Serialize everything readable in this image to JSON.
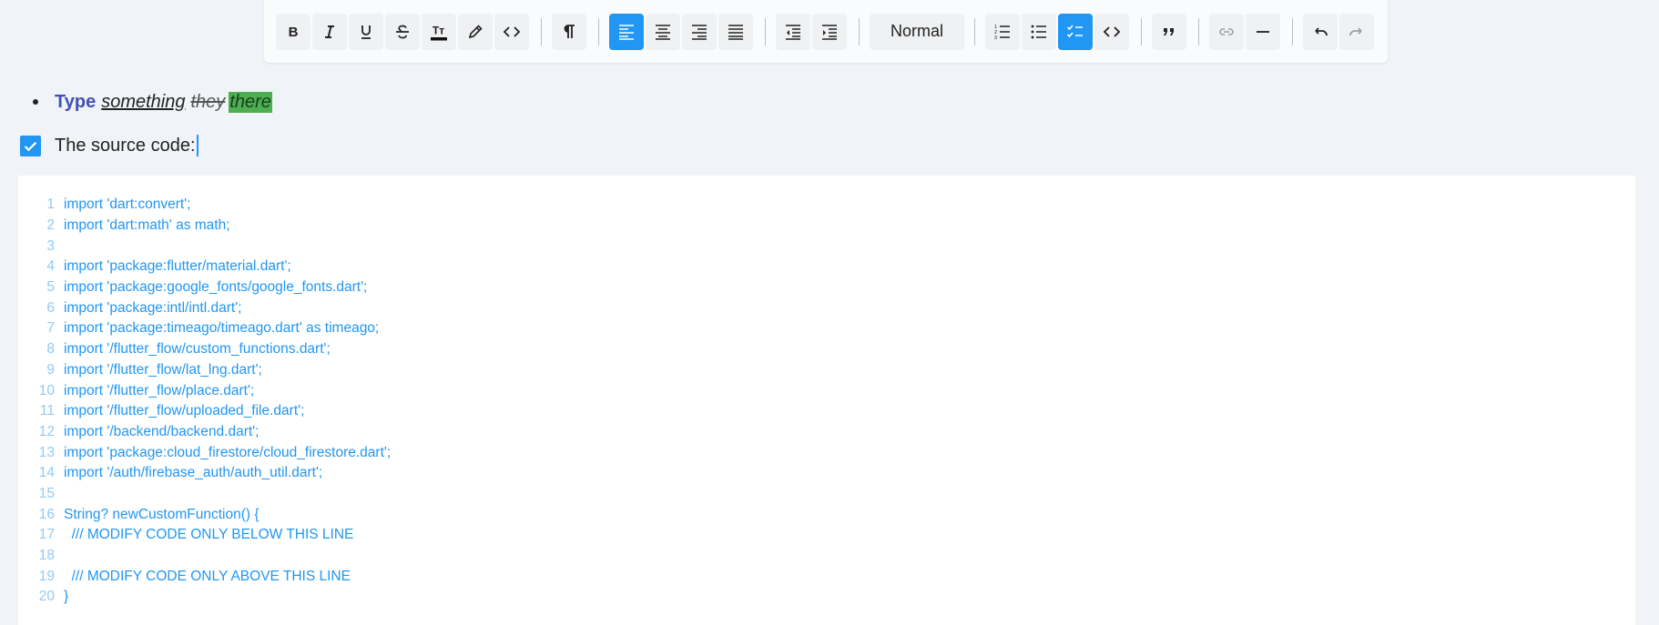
{
  "toolbar": {
    "style_select": "Normal",
    "buttons": [
      {
        "name": "bold-button",
        "icon": "bold-icon"
      },
      {
        "name": "italic-button",
        "icon": "italic-icon"
      },
      {
        "name": "underline-button",
        "icon": "underline-icon"
      },
      {
        "name": "strikethrough-button",
        "icon": "strikethrough-icon"
      },
      {
        "name": "text-color-button",
        "icon": "text-color-icon"
      },
      {
        "name": "highlight-button",
        "icon": "pen-icon"
      },
      {
        "name": "inline-code-button",
        "icon": "code-icon"
      },
      {
        "name": "show-formatting-button",
        "icon": "pilcrow-icon"
      },
      {
        "name": "align-left-button",
        "icon": "align-left-icon",
        "active": true
      },
      {
        "name": "align-center-button",
        "icon": "align-center-icon"
      },
      {
        "name": "align-right-button",
        "icon": "align-right-icon"
      },
      {
        "name": "align-justify-button",
        "icon": "align-justify-icon"
      },
      {
        "name": "outdent-button",
        "icon": "outdent-icon"
      },
      {
        "name": "indent-button",
        "icon": "indent-icon"
      },
      {
        "name": "ordered-list-button",
        "icon": "ordered-list-icon"
      },
      {
        "name": "bullet-list-button",
        "icon": "bullet-list-icon"
      },
      {
        "name": "checklist-button",
        "icon": "checklist-icon",
        "active": true
      },
      {
        "name": "code-block-button",
        "icon": "code-icon"
      },
      {
        "name": "quote-button",
        "icon": "quote-icon"
      },
      {
        "name": "link-button",
        "icon": "link-icon",
        "disabled": true
      },
      {
        "name": "horizontal-rule-button",
        "icon": "horizontal-rule-icon"
      },
      {
        "name": "undo-button",
        "icon": "undo-icon"
      },
      {
        "name": "redo-button",
        "icon": "redo-icon",
        "disabled": true
      }
    ]
  },
  "colors": {
    "accent": "#2196f3",
    "bold_text": "#3f51b5",
    "highlight": "#4caf50",
    "code_text": "#2196f3",
    "line_number": "#90caf9"
  },
  "content": {
    "bullet": {
      "bold": "Type",
      "italic_underline": "something",
      "strikethrough": "they",
      "highlighted": "there"
    },
    "checklist": {
      "checked": true,
      "text": "The source code:"
    }
  },
  "code_block": {
    "lines": [
      {
        "n": "1",
        "code": "import 'dart:convert';"
      },
      {
        "n": "2",
        "code": "import 'dart:math' as math;"
      },
      {
        "n": "3",
        "code": ""
      },
      {
        "n": "4",
        "code": "import 'package:flutter/material.dart';"
      },
      {
        "n": "5",
        "code": "import 'package:google_fonts/google_fonts.dart';"
      },
      {
        "n": "6",
        "code": "import 'package:intl/intl.dart';"
      },
      {
        "n": "7",
        "code": "import 'package:timeago/timeago.dart' as timeago;"
      },
      {
        "n": "8",
        "code": "import '/flutter_flow/custom_functions.dart';"
      },
      {
        "n": "9",
        "code": "import '/flutter_flow/lat_lng.dart';"
      },
      {
        "n": "10",
        "code": "import '/flutter_flow/place.dart';"
      },
      {
        "n": "11",
        "code": "import '/flutter_flow/uploaded_file.dart';"
      },
      {
        "n": "12",
        "code": "import '/backend/backend.dart';"
      },
      {
        "n": "13",
        "code": "import 'package:cloud_firestore/cloud_firestore.dart';"
      },
      {
        "n": "14",
        "code": "import '/auth/firebase_auth/auth_util.dart';"
      },
      {
        "n": "15",
        "code": ""
      },
      {
        "n": "16",
        "code": "String? newCustomFunction() {"
      },
      {
        "n": "17",
        "code": "  /// MODIFY CODE ONLY BELOW THIS LINE"
      },
      {
        "n": "18",
        "code": ""
      },
      {
        "n": "19",
        "code": "  /// MODIFY CODE ONLY ABOVE THIS LINE"
      },
      {
        "n": "20",
        "code": "}"
      }
    ]
  }
}
